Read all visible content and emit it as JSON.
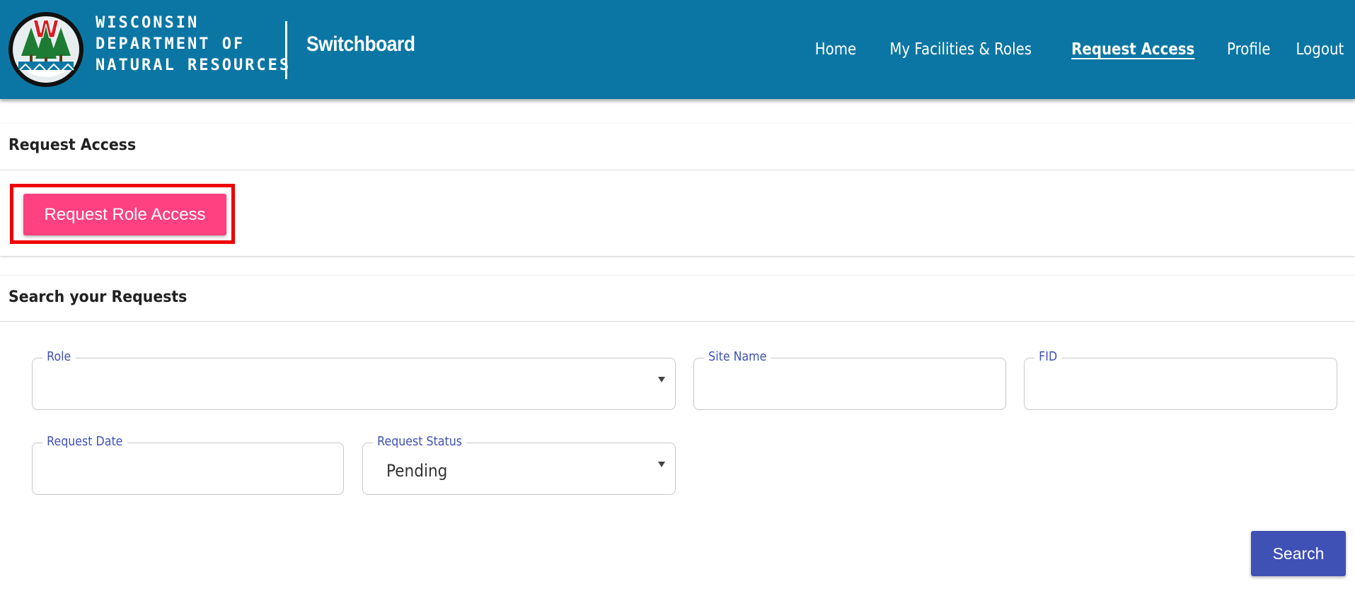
{
  "header": {
    "agency_lines": [
      "WISCONSIN",
      "DEPARTMENT OF",
      "NATURAL RESOURCES"
    ],
    "app_name": "Switchboard",
    "logo_letter": "W",
    "colors": {
      "header_bg": "#0b76a4",
      "logo_green": "#1e7b34",
      "logo_red": "#d42027"
    }
  },
  "nav": {
    "items": [
      {
        "label": "Home",
        "active": false
      },
      {
        "label": "My Facilities & Roles",
        "active": false
      },
      {
        "label": "Request Access",
        "active": true
      },
      {
        "label": "Profile",
        "active": false
      },
      {
        "label": "Logout",
        "active": false
      }
    ]
  },
  "request_card": {
    "title": "Request Access",
    "button_label": "Request Role Access",
    "button_color": "#ff4081",
    "highlight_color": "#ee0000"
  },
  "search_card": {
    "title": "Search your Requests",
    "fields": {
      "role": {
        "label": "Role",
        "value": ""
      },
      "site_name": {
        "label": "Site Name",
        "value": ""
      },
      "fid": {
        "label": "FID",
        "value": ""
      },
      "request_date": {
        "label": "Request Date",
        "value": ""
      },
      "request_status": {
        "label": "Request Status",
        "value": "Pending"
      }
    },
    "search_button_label": "Search",
    "search_button_color": "#3f51b5"
  }
}
